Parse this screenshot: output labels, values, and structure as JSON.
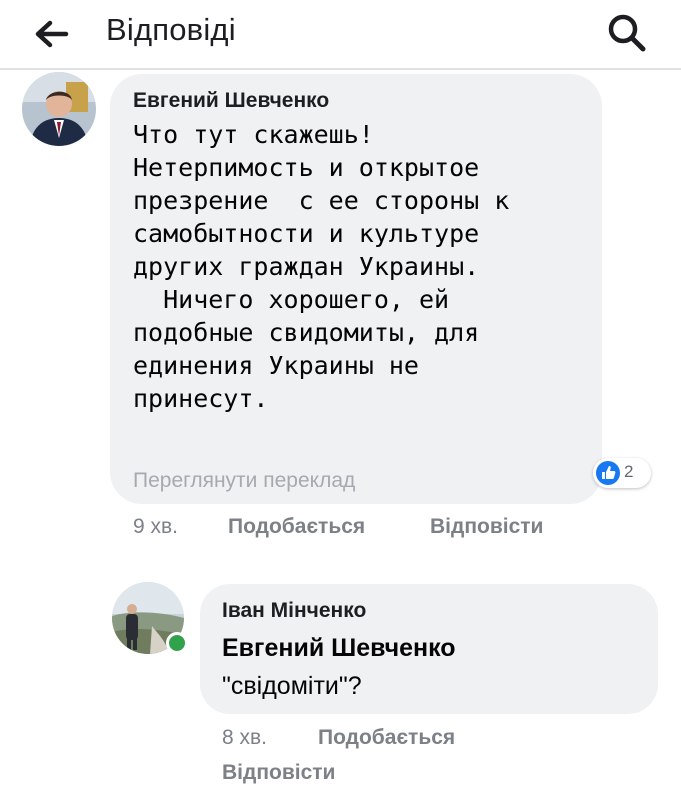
{
  "header": {
    "title": "Відповіді",
    "back_icon": "arrow-left-icon",
    "search_icon": "search-icon"
  },
  "comment": {
    "author": "Евгений Шевченко",
    "text": "Что тут скажешь!\nНетерпимость и открытое\nпрезрение  с ее стороны к\nсамобытности и культуре\nдругих граждан Украины.\n  Ничего хорошего, ей\nподобные свидомиты, для\nединения Украины не\nпринесут.",
    "translate_label": "Переглянути переклад",
    "reaction_count": "2",
    "reaction_icon": "like-icon",
    "time": "9 хв.",
    "like_label": "Подобається",
    "reply_label": "Відповісти"
  },
  "reply": {
    "author": "Іван Мінченко",
    "mention": "Евгений Шевченко",
    "text": "\"свідоміти\"?",
    "time": "8 хв.",
    "like_label": "Подобається",
    "reply_label": "Відповісти",
    "online": true
  },
  "colors": {
    "bubble": "#eff1f3",
    "like_blue": "#1778f2",
    "online_green": "#31a24c",
    "meta_gray": "#7c8087"
  }
}
